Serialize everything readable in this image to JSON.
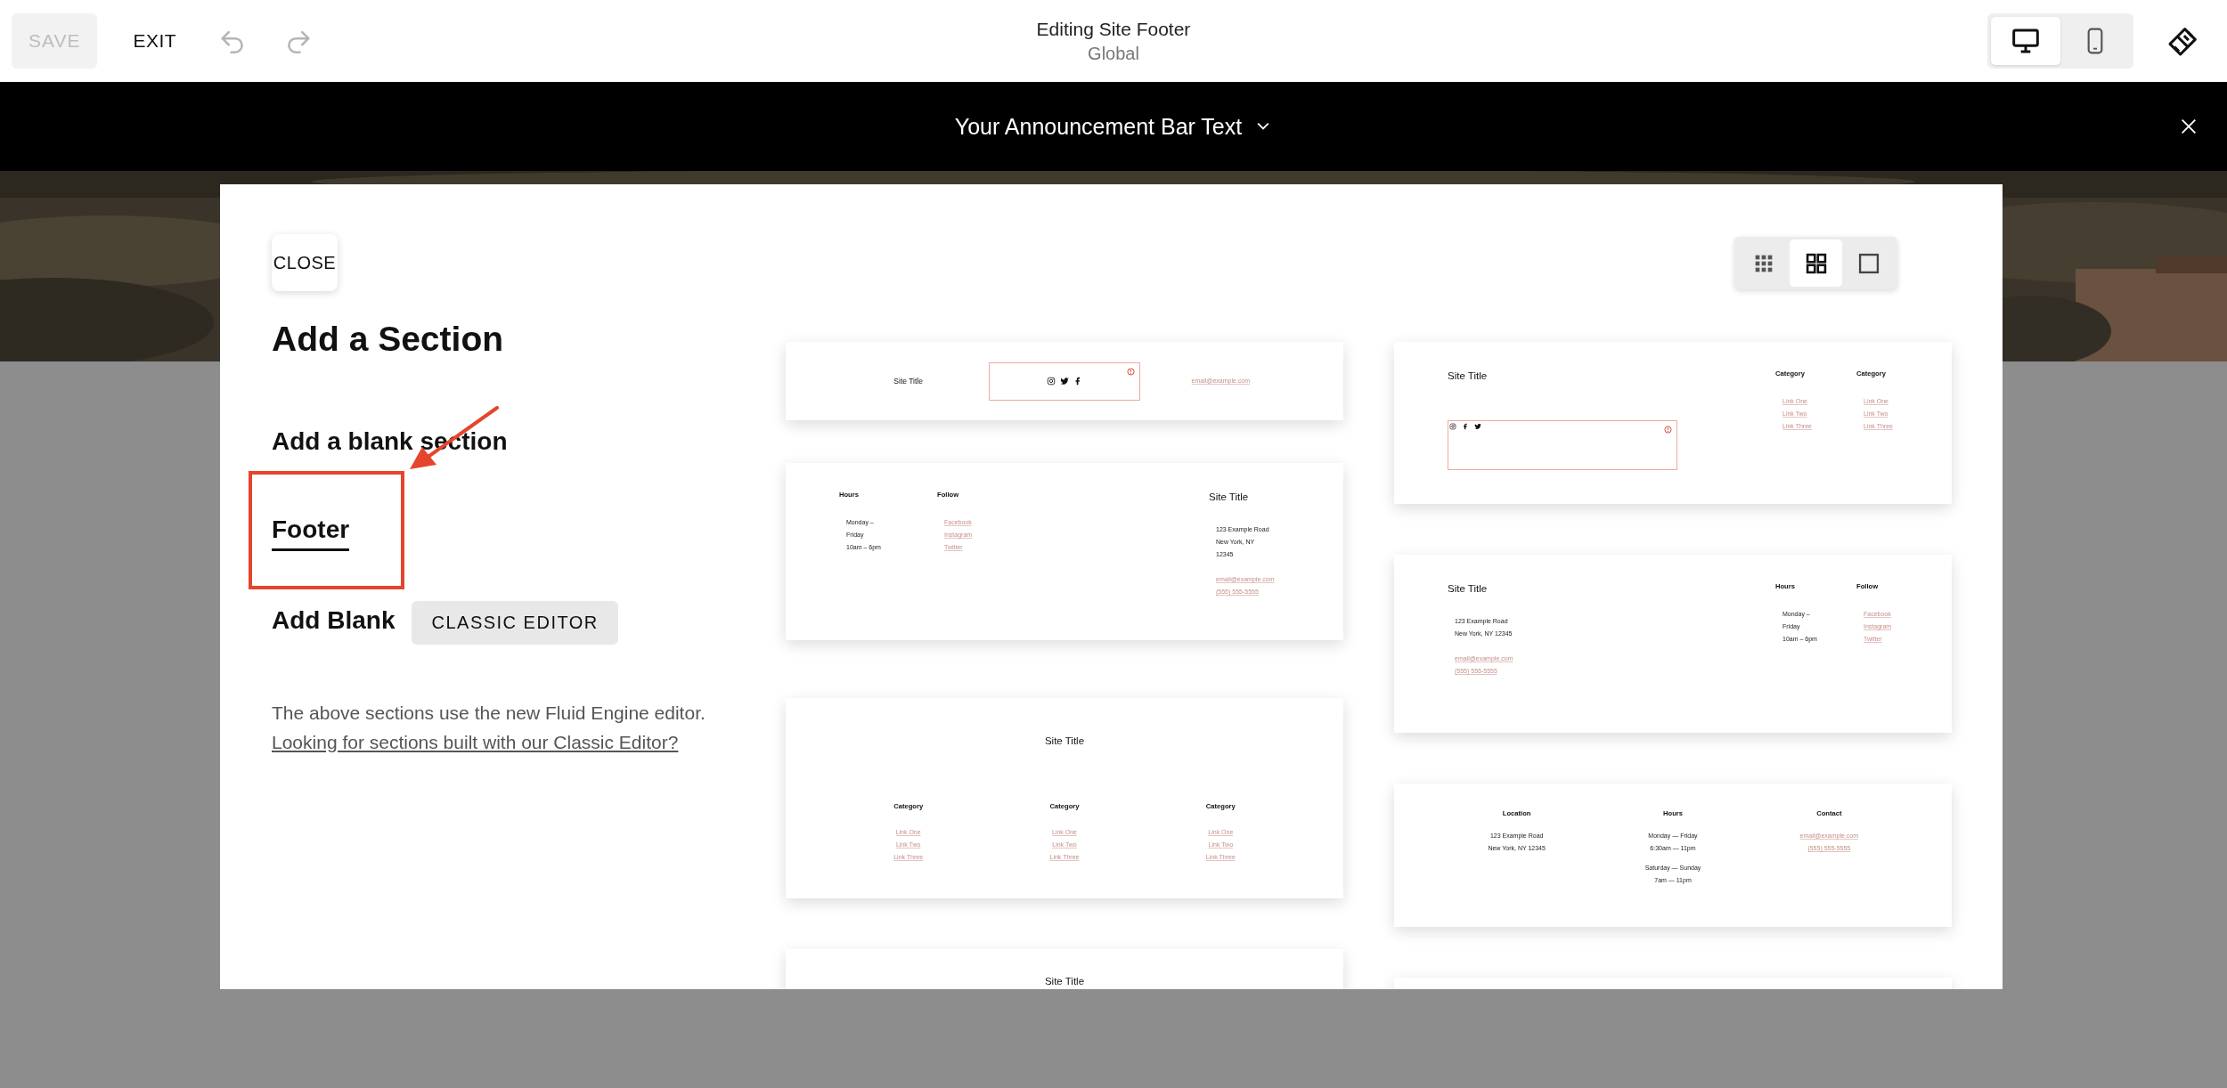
{
  "top_bar": {
    "save": {
      "label": "SAVE",
      "disabled": true
    },
    "exit": "EXIT",
    "undo": {
      "disabled": true
    },
    "redo": {
      "disabled": true
    },
    "title": "Editing Site Footer",
    "subtitle": "Global",
    "devices": [
      {
        "kind": "desktop",
        "selected": true
      },
      {
        "kind": "mobile",
        "selected": false
      }
    ]
  },
  "announcement_bar": {
    "text": "Your Announcement Bar Text"
  },
  "modal": {
    "close": "CLOSE",
    "title": "Add a Section",
    "menu": [
      {
        "label": "Add a blank section",
        "selected": false
      },
      {
        "label": "Footer",
        "selected": true
      },
      {
        "label": "Add Blank",
        "selected": false,
        "button": "CLASSIC EDITOR"
      }
    ],
    "note": {
      "text": "The above sections use the new Fluid Engine editor.",
      "link": "Looking for sections built with our Classic Editor?"
    },
    "view_options": [
      {
        "kind": "small-grid",
        "selected": false
      },
      {
        "kind": "grid",
        "selected": true
      },
      {
        "kind": "single",
        "selected": false
      }
    ],
    "template_columns": [
      {
        "cards": [
          {
            "kind": "inline",
            "columns": [
              {
                "blocks": [
                  {
                    "kind": "title",
                    "text": "Site Title"
                  }
                ]
              },
              {
                "blocks": [
                  {
                    "kind": "social",
                    "warning": true,
                    "icons": [
                      {
                        "kind": "camera"
                      },
                      {
                        "kind": "bird"
                      },
                      {
                        "kind": "letter-f"
                      }
                    ]
                  }
                ]
              },
              {
                "blocks": [
                  {
                    "kind": "links",
                    "lines": [
                      "email@example.com"
                    ]
                  }
                ]
              }
            ]
          },
          {
            "kind": "split",
            "left": [
              {
                "blocks": [
                  {
                    "kind": "heading",
                    "text": "Hours"
                  },
                  {
                    "kind": "text",
                    "lines": [
                      "Monday –",
                      "Friday",
                      "10am – 6pm"
                    ]
                  }
                ]
              },
              {
                "blocks": [
                  {
                    "kind": "heading",
                    "text": "Follow"
                  },
                  {
                    "kind": "links",
                    "lines": [
                      "Facebook",
                      "Instagram",
                      "Twitter"
                    ]
                  }
                ]
              }
            ],
            "right": [
              {
                "blocks": [
                  {
                    "kind": "title",
                    "text": "Site Title"
                  },
                  {
                    "kind": "text",
                    "lines": [
                      "123 Example Road",
                      "New York, NY",
                      "12345"
                    ]
                  },
                  {
                    "kind": "links",
                    "lines": [
                      "email@example.com",
                      "(555) 555-5555"
                    ]
                  }
                ]
              }
            ]
          },
          {
            "kind": "stacked",
            "title": "Site Title",
            "columns": [
              {
                "blocks": [
                  {
                    "kind": "heading",
                    "text": "Category"
                  },
                  {
                    "kind": "links",
                    "lines": [
                      "Link One",
                      "Link Two",
                      "Link Three"
                    ]
                  }
                ]
              },
              {
                "blocks": [
                  {
                    "kind": "heading",
                    "text": "Category"
                  },
                  {
                    "kind": "links",
                    "lines": [
                      "Link One",
                      "Link Two",
                      "Link Three"
                    ]
                  }
                ]
              },
              {
                "blocks": [
                  {
                    "kind": "heading",
                    "text": "Category"
                  },
                  {
                    "kind": "links",
                    "lines": [
                      "Link One",
                      "Link Two",
                      "Link Three"
                    ]
                  }
                ]
              }
            ]
          },
          {
            "kind": "stacked",
            "title": "Site Title"
          }
        ]
      },
      {
        "cards": [
          {
            "kind": "split",
            "left": [
              {
                "blocks": [
                  {
                    "kind": "title",
                    "text": "Site Title"
                  },
                  {
                    "kind": "social",
                    "warning": true,
                    "icons": [
                      {
                        "kind": "camera"
                      },
                      {
                        "kind": "letter-f"
                      },
                      {
                        "kind": "bird"
                      }
                    ]
                  }
                ]
              }
            ],
            "right": [
              {
                "blocks": [
                  {
                    "kind": "heading",
                    "text": "Category"
                  },
                  {
                    "kind": "links",
                    "lines": [
                      "Link One",
                      "Link Two",
                      "Link Three"
                    ]
                  }
                ]
              },
              {
                "blocks": [
                  {
                    "kind": "heading",
                    "text": "Category"
                  },
                  {
                    "kind": "links",
                    "lines": [
                      "Link One",
                      "Link Two",
                      "Link Three"
                    ]
                  }
                ]
              }
            ]
          },
          {
            "kind": "split",
            "left": [
              {
                "blocks": [
                  {
                    "kind": "title",
                    "text": "Site Title"
                  },
                  {
                    "kind": "text",
                    "lines": [
                      "123 Example Road",
                      "New York, NY 12345"
                    ]
                  },
                  {
                    "kind": "links",
                    "lines": [
                      "email@example.com",
                      "(555) 555-5555"
                    ]
                  }
                ]
              }
            ],
            "right": [
              {
                "blocks": [
                  {
                    "kind": "heading",
                    "text": "Hours"
                  },
                  {
                    "kind": "text",
                    "lines": [
                      "Monday –",
                      "Friday",
                      "10am – 6pm"
                    ]
                  }
                ]
              },
              {
                "blocks": [
                  {
                    "kind": "heading",
                    "text": "Follow"
                  },
                  {
                    "kind": "links",
                    "lines": [
                      "Facebook",
                      "Instagram",
                      "Twitter"
                    ]
                  }
                ]
              }
            ]
          },
          {
            "kind": "columns",
            "columns": [
              {
                "blocks": [
                  {
                    "kind": "heading",
                    "text": "Location"
                  },
                  {
                    "kind": "text",
                    "lines": [
                      "123 Example Road",
                      "New York, NY 12345"
                    ]
                  }
                ]
              },
              {
                "blocks": [
                  {
                    "kind": "heading",
                    "text": "Hours"
                  },
                  {
                    "kind": "text",
                    "lines": [
                      "Monday — Friday",
                      "6:30am — 11pm"
                    ]
                  },
                  {
                    "kind": "text",
                    "lines": [
                      "Saturday — Sunday",
                      "7am — 11pm"
                    ]
                  }
                ]
              },
              {
                "blocks": [
                  {
                    "kind": "heading",
                    "text": "Contact"
                  },
                  {
                    "kind": "links",
                    "lines": [
                      "email@example.com",
                      "(555) 555-5555"
                    ]
                  }
                ]
              }
            ]
          },
          {
            "kind": "blank"
          }
        ]
      }
    ]
  }
}
